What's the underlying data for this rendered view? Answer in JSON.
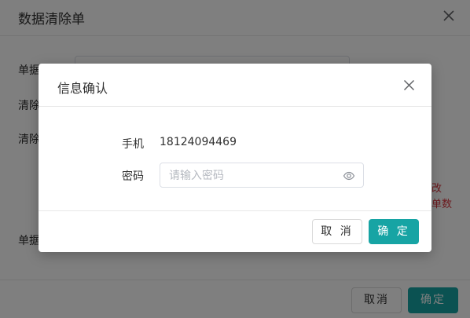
{
  "background_dialog": {
    "title": "数据清除单",
    "labels": [
      "单据",
      "清除",
      "清除",
      "单据"
    ],
    "warning_texts": [
      "改",
      "单数"
    ],
    "cancel_label": "取消",
    "ok_label": "确定"
  },
  "modal": {
    "title": "信息确认",
    "phone_label": "手机",
    "phone_value": "18124094469",
    "password_label": "密码",
    "password_placeholder": "请输入密码",
    "password_value": "",
    "cancel_label": "取 消",
    "ok_label": "确 定"
  },
  "colors": {
    "accent": "#17a4a4",
    "warning": "#d9363e"
  },
  "icons": {
    "bg_close": "close-icon",
    "modal_close": "close-icon",
    "password_toggle": "eye-icon"
  }
}
